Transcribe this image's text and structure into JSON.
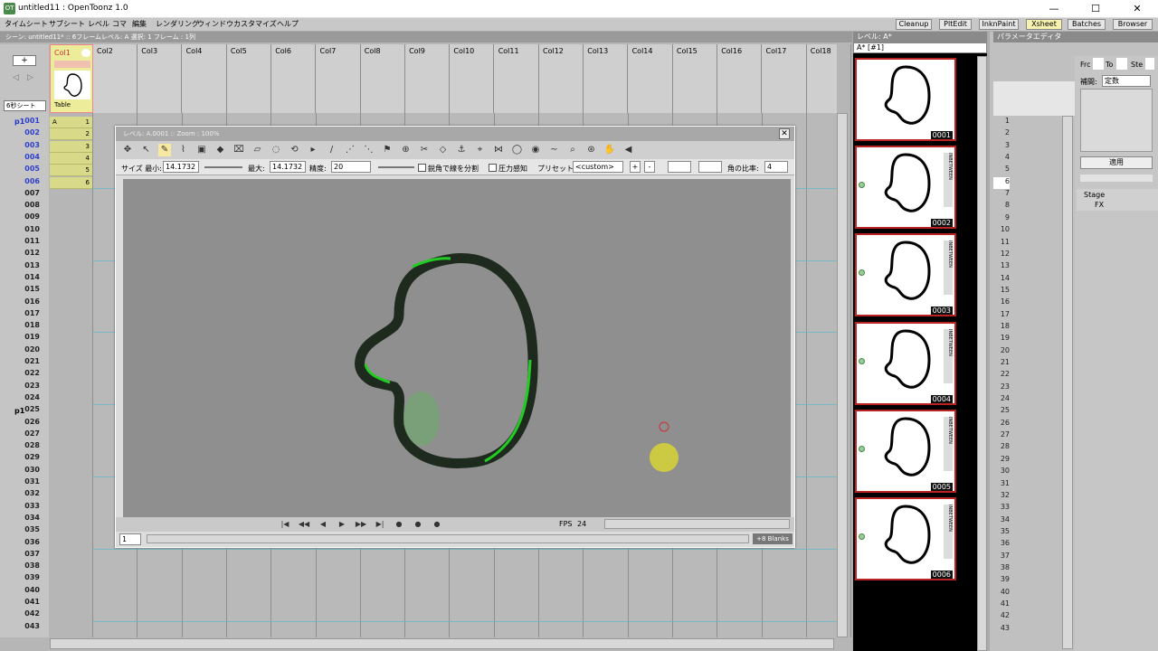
{
  "window": {
    "title": "untitled11 : OpenToonz 1.0",
    "icon_label": "OT",
    "minimize": "—",
    "maximize": "☐",
    "close": "✕"
  },
  "menus": [
    "タイムシート",
    "サブシート",
    "レベル",
    "コマ",
    "編集",
    "レンダリング",
    "ウィンドウ",
    "カスタマイズ",
    "ヘルプ"
  ],
  "rooms": [
    "Cleanup",
    "PltEdit",
    "InknPaint",
    "Xsheet",
    "Batches",
    "Browser"
  ],
  "active_room": "Xsheet",
  "xsheet": {
    "scene_info": "シーン: untitled11*  ::  6フレームレベル: A  選択: 1 フレーム : 1列",
    "sheet_select": "6秒シート",
    "columns": [
      "Col1",
      "Col2",
      "Col3",
      "Col4",
      "Col5",
      "Col6",
      "Col7",
      "Col8",
      "Col9",
      "Col10",
      "Col11",
      "Col12",
      "Col13",
      "Col14",
      "Col15",
      "Col16",
      "Col17",
      "Col18"
    ],
    "col1_table": "Table",
    "page_marker_1": "p1",
    "page_marker_2": "p1",
    "rows": [
      "001",
      "002",
      "003",
      "004",
      "005",
      "006",
      "007",
      "008",
      "009",
      "010",
      "011",
      "012",
      "013",
      "014",
      "015",
      "016",
      "017",
      "018",
      "019",
      "020",
      "021",
      "022",
      "023",
      "024",
      "025",
      "026",
      "027",
      "028",
      "029",
      "030",
      "031",
      "032",
      "033",
      "034",
      "035",
      "036",
      "037",
      "038",
      "039",
      "040",
      "041",
      "042",
      "043"
    ],
    "cells": [
      {
        "level": "A",
        "frame": "1"
      },
      {
        "level": "",
        "frame": "2"
      },
      {
        "level": "",
        "frame": "3"
      },
      {
        "level": "",
        "frame": "4"
      },
      {
        "level": "",
        "frame": "5"
      },
      {
        "level": "",
        "frame": "6"
      }
    ]
  },
  "viewer": {
    "header": "レベル: A.0001  ::  Zoom : 100%",
    "size_min_label": "サイズ 最小:",
    "size_min": "14.1732",
    "size_max_label": "最大:",
    "size_max": "14.1732",
    "accuracy_label": "精度:",
    "accuracy": "20",
    "break_label": "鋭角で線を分割",
    "pressure_label": "圧力感知",
    "preset_label": "プリセット:",
    "preset": "<custom>",
    "add": "+",
    "remove": "-",
    "cap_ratio_label": "角の比率:",
    "cap_ratio": "4",
    "fps_label": "FPS",
    "fps": "24",
    "frame": "1",
    "blanks": "+8 Blanks"
  },
  "level_strip": {
    "header": "レベル: A*",
    "dropdown": "A* [#1]",
    "frames": [
      "0001",
      "0002",
      "0003",
      "0004",
      "0005",
      "0006"
    ],
    "tag": "INBETWEEN"
  },
  "param_editor": {
    "header": "パラメータエディタ",
    "from_label": "Frc",
    "to_label": "To",
    "step_label": "Ste",
    "interp_label": "補間:",
    "interp_value": "定数",
    "apply": "適用",
    "tree": [
      "Stage",
      "FX"
    ],
    "rows": [
      "1",
      "2",
      "3",
      "4",
      "5",
      "6",
      "7",
      "8",
      "9",
      "10",
      "11",
      "12",
      "13",
      "14",
      "15",
      "16",
      "17",
      "18",
      "19",
      "20",
      "21",
      "22",
      "23",
      "24",
      "25",
      "26",
      "27",
      "28",
      "29",
      "30",
      "31",
      "32",
      "33",
      "34",
      "35",
      "36",
      "37",
      "38",
      "39",
      "40",
      "41",
      "42",
      "43"
    ]
  },
  "colors": {
    "stroke": "#1e2a1e",
    "green": "#22cc22",
    "canvas": "#8f8f8f",
    "cell": "#d9d98a",
    "thumb_border": "#b22222"
  }
}
